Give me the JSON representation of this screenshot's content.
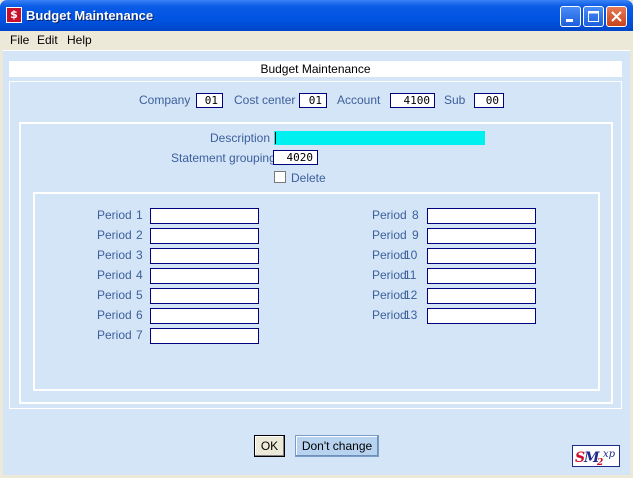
{
  "window": {
    "title": "Budget Maintenance",
    "app_icon": "app-icon",
    "controls": [
      "minimize-icon",
      "maximize-icon",
      "close-icon"
    ]
  },
  "menu": {
    "items": [
      "File",
      "Edit",
      "Help"
    ]
  },
  "form": {
    "header": "Budget Maintenance",
    "key": {
      "company_label": "Company",
      "company_value": "01",
      "cost_center_label": "Cost center",
      "cost_center_value": "01",
      "account_label": "Account",
      "account_value": "4100",
      "sub_label": "Sub",
      "sub_value": "00"
    },
    "description_label": "Description",
    "description_value": "",
    "statement_grouping_label": "Statement grouping",
    "statement_grouping_value": "4020",
    "delete_label": "Delete",
    "delete_checked": false,
    "periods_left": [
      {
        "label": "Period",
        "num": "1",
        "value": ""
      },
      {
        "label": "Period",
        "num": "2",
        "value": ""
      },
      {
        "label": "Period",
        "num": "3",
        "value": ""
      },
      {
        "label": "Period",
        "num": "4",
        "value": ""
      },
      {
        "label": "Period",
        "num": "5",
        "value": ""
      },
      {
        "label": "Period",
        "num": "6",
        "value": ""
      },
      {
        "label": "Period",
        "num": "7",
        "value": ""
      }
    ],
    "periods_right": [
      {
        "label": "Period",
        "num": "8",
        "value": ""
      },
      {
        "label": "Period",
        "num": "9",
        "value": ""
      },
      {
        "label": "Period",
        "num": "10",
        "value": ""
      },
      {
        "label": "Period",
        "num": "11",
        "value": ""
      },
      {
        "label": "Period",
        "num": "12",
        "value": ""
      },
      {
        "label": "Period",
        "num": "13",
        "value": ""
      }
    ]
  },
  "buttons": {
    "ok": "OK",
    "dont_change": "Don't change"
  },
  "logo": {
    "text": "SM2xp",
    "icon": "sm2xp-logo"
  },
  "colors": {
    "titlebar": "#0054e3",
    "client_bg": "#d4e5f7",
    "label": "#3c5f9c",
    "highlight": "#00f0f0"
  }
}
